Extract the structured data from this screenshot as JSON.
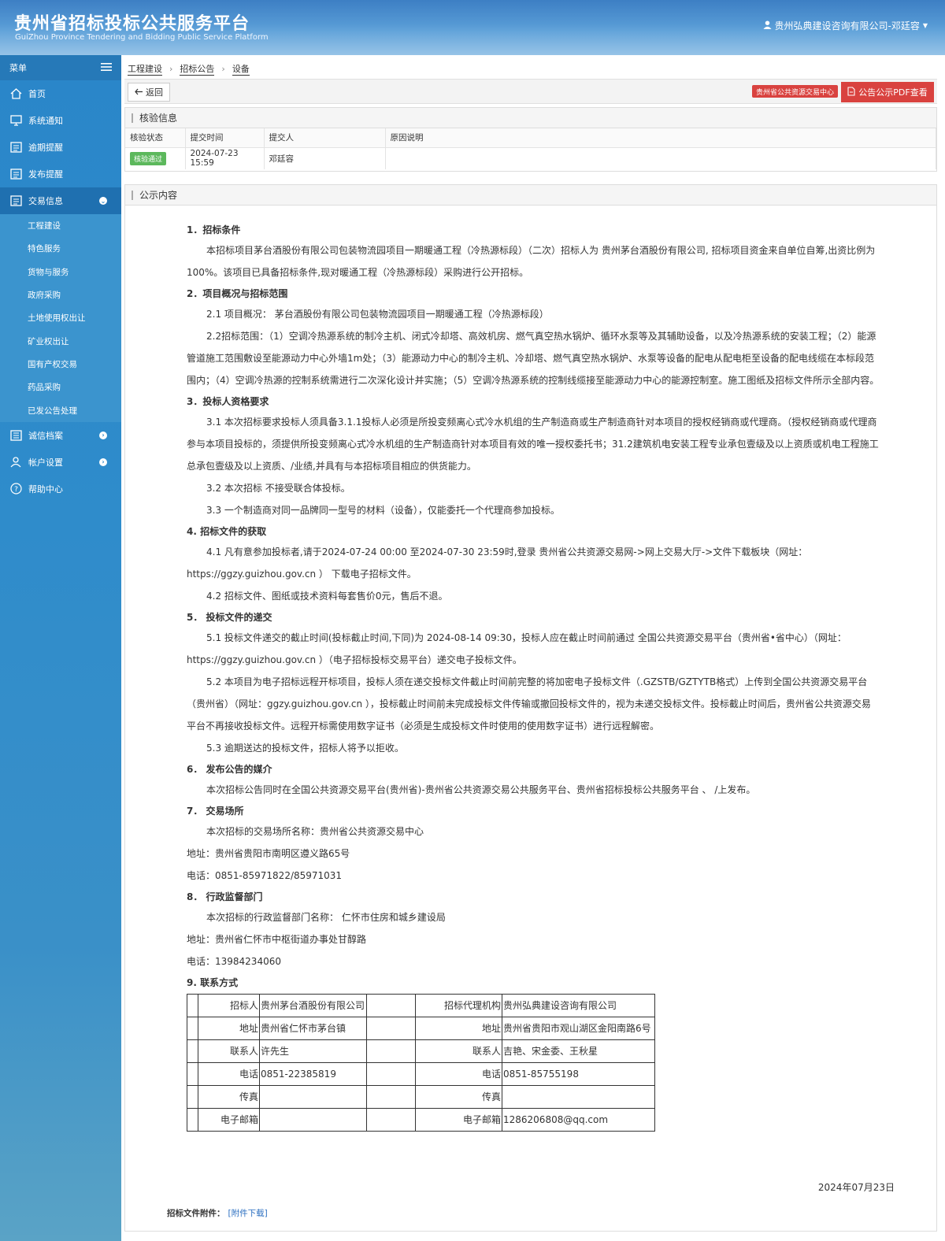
{
  "header": {
    "title": "贵州省招标投标公共服务平台",
    "subtitle": "GuiZhou Province Tendering and Bidding Public Service Platform",
    "user": "贵州弘典建设咨询有限公司-邓廷容"
  },
  "sidebar": {
    "menu_label": "菜单",
    "items": [
      {
        "label": "首页",
        "icon": "home-icon"
      },
      {
        "label": "系统通知",
        "icon": "monitor-icon"
      },
      {
        "label": "逾期提醒",
        "icon": "list-icon"
      },
      {
        "label": "发布提醒",
        "icon": "list-icon"
      },
      {
        "label": "交易信息",
        "icon": "list-icon"
      },
      {
        "label": "诚信档案",
        "icon": "document-icon"
      },
      {
        "label": "帐户设置",
        "icon": "user-icon"
      },
      {
        "label": "帮助中心",
        "icon": "help-icon"
      }
    ],
    "sub_items": [
      "工程建设",
      "特色服务",
      "货物与服务",
      "政府采购",
      "土地使用权出让",
      "矿业权出让",
      "国有产权交易",
      "药品采购",
      "已发公告处理"
    ]
  },
  "breadcrumb": [
    "工程建设",
    "招标公告",
    "设备"
  ],
  "toolbar": {
    "back": "返回",
    "center_badge": "贵州省公共资源交易中心",
    "pdf": "公告公示PDF查看"
  },
  "verify": {
    "title": "核验信息",
    "headers": [
      "核验状态",
      "提交时间",
      "提交人",
      "原因说明"
    ],
    "status": "核验通过",
    "time": "2024-07-23 15:59",
    "submitter": "邓廷容",
    "reason": ""
  },
  "content": {
    "title": "公示内容",
    "s1_h": "1．招标条件",
    "s1_p": "本招标项目茅台酒股份有限公司包装物流园项目一期暖通工程（冷热源标段）（二次）招标人为 贵州茅台酒股份有限公司, 招标项目资金来自单位自筹,出资比例为100%。该项目已具备招标条件,现对暖通工程（冷热源标段）采购进行公开招标。",
    "s2_h": "2．项目概况与招标范围",
    "s2_p1": "2.1 项目概况： 茅台酒股份有限公司包装物流园项目一期暖通工程（冷热源标段）",
    "s2_p2": "2.2招标范围：（1）空调冷热源系统的制冷主机、闭式冷却塔、高效机房、燃气真空热水锅炉、循环水泵等及其辅助设备，以及冷热源系统的安装工程；（2）能源管道施工范围敷设至能源动力中心外墙1m处；（3）能源动力中心的制冷主机、冷却塔、燃气真空热水锅炉、水泵等设备的配电从配电柜至设备的配电线缆在本标段范围内；（4）空调冷热源的控制系统需进行二次深化设计并实施；（5）空调冷热源系统的控制线缆接至能源动力中心的能源控制室。施工图纸及招标文件所示全部内容。",
    "s3_h": "3．投标人资格要求",
    "s3_p1": "3.1 本次招标要求投标人须具备3.1.1投标人必须是所投变频离心式冷水机组的生产制造商或生产制造商针对本项目的授权经销商或代理商。（授权经销商或代理商参与本项目投标的，须提供所投变频离心式冷水机组的生产制造商针对本项目有效的唯一授权委托书；31.2建筑机电安装工程专业承包壹级及以上资质或机电工程施工总承包壹级及以上资质、/业绩,并具有与本招标项目相应的供货能力。",
    "s3_p2": "3.2 本次招标 不接受联合体投标。",
    "s3_p3": "3.3 一个制造商对同一品牌同一型号的材料（设备），仅能委托一个代理商参加投标。",
    "s4_h": "4. 招标文件的获取",
    "s4_p1": "4.1 凡有意参加投标者,请于2024-07-24 00:00 至2024-07-30 23:59时,登录 贵州省公共资源交易网->网上交易大厅->文件下载板块（网址：https://ggzy.guizhou.gov.cn ） 下载电子招标文件。",
    "s4_p2": "4.2 招标文件、图纸或技术资料每套售价0元，售后不退。",
    "s5_h": "5． 投标文件的递交",
    "s5_p1": "5.1 投标文件递交的截止时间(投标截止时间,下同)为 2024-08-14 09:30，投标人应在截止时间前通过 全国公共资源交易平台（贵州省•省中心）（网址：https://ggzy.guizhou.gov.cn ）（电子招标投标交易平台）递交电子投标文件。",
    "s5_p2": "5.2 本项目为电子招标远程开标项目，投标人须在递交投标文件截止时间前完整的将加密电子投标文件（.GZSTB/GZTYTB格式）上传到全国公共资源交易平台（贵州省）（网址：ggzy.guizhou.gov.cn ），投标截止时间前未完成投标文件传输或撤回投标文件的，视为未递交投标文件。投标截止时间后，贵州省公共资源交易平台不再接收投标文件。远程开标需使用数字证书（必须是生成投标文件时使用的使用数字证书）进行远程解密。",
    "s5_p3": "5.3 逾期送达的投标文件，招标人将予以拒收。",
    "s6_h": "6． 发布公告的媒介",
    "s6_p": "本次招标公告同时在全国公共资源交易平台(贵州省)-贵州省公共资源交易公共服务平台、贵州省招标投标公共服务平台 、 /上发布。",
    "s7_h": "7． 交易场所",
    "s7_p1": "本次招标的交易场所名称：贵州省公共资源交易中心",
    "s7_p2": "地址：贵州省贵阳市南明区遵义路65号",
    "s7_p3": "电话：0851-85971822/85971031",
    "s8_h": "8． 行政监督部门",
    "s8_p1": "本次招标的行政监督部门名称： 仁怀市住房和城乡建设局",
    "s8_p2": "地址：贵州省仁怀市中枢街道办事处甘醇路",
    "s8_p3": "电话：13984234060",
    "s9_h": "9. 联系方式",
    "contact": [
      [
        "招标人",
        "贵州茅台酒股份有限公司",
        "招标代理机构",
        "贵州弘典建设咨询有限公司"
      ],
      [
        "地址",
        "贵州省仁怀市茅台镇",
        "地址",
        "贵州省贵阳市观山湖区金阳南路6号"
      ],
      [
        "联系人",
        "许先生",
        "联系人",
        "吉艳、宋金委、王秋星"
      ],
      [
        "电话",
        "0851-22385819",
        "电话",
        "0851-85755198"
      ],
      [
        "传真",
        "",
        "传真",
        ""
      ],
      [
        "电子邮箱",
        "",
        "电子邮箱",
        "1286206808@qq.com"
      ]
    ],
    "date": "2024年07月23日",
    "attach_label": "招标文件附件：",
    "attach_link": "[附件下载]"
  }
}
